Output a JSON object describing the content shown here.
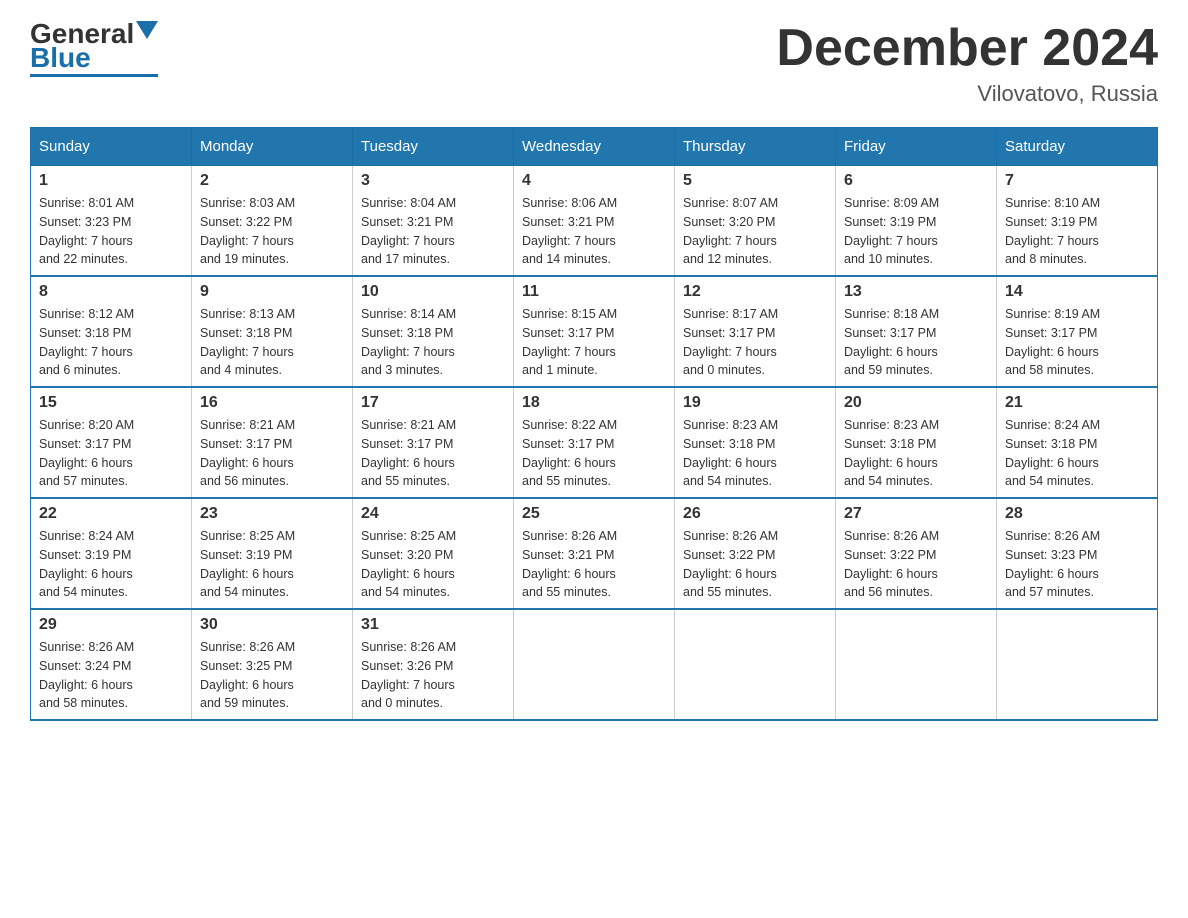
{
  "header": {
    "logo_general": "General",
    "logo_blue": "Blue",
    "month_title": "December 2024",
    "location": "Vilovatovo, Russia"
  },
  "calendar": {
    "days_of_week": [
      "Sunday",
      "Monday",
      "Tuesday",
      "Wednesday",
      "Thursday",
      "Friday",
      "Saturday"
    ],
    "weeks": [
      [
        {
          "day": "1",
          "sunrise": "8:01 AM",
          "sunset": "3:23 PM",
          "daylight": "7 hours and 22 minutes."
        },
        {
          "day": "2",
          "sunrise": "8:03 AM",
          "sunset": "3:22 PM",
          "daylight": "7 hours and 19 minutes."
        },
        {
          "day": "3",
          "sunrise": "8:04 AM",
          "sunset": "3:21 PM",
          "daylight": "7 hours and 17 minutes."
        },
        {
          "day": "4",
          "sunrise": "8:06 AM",
          "sunset": "3:21 PM",
          "daylight": "7 hours and 14 minutes."
        },
        {
          "day": "5",
          "sunrise": "8:07 AM",
          "sunset": "3:20 PM",
          "daylight": "7 hours and 12 minutes."
        },
        {
          "day": "6",
          "sunrise": "8:09 AM",
          "sunset": "3:19 PM",
          "daylight": "7 hours and 10 minutes."
        },
        {
          "day": "7",
          "sunrise": "8:10 AM",
          "sunset": "3:19 PM",
          "daylight": "7 hours and 8 minutes."
        }
      ],
      [
        {
          "day": "8",
          "sunrise": "8:12 AM",
          "sunset": "3:18 PM",
          "daylight": "7 hours and 6 minutes."
        },
        {
          "day": "9",
          "sunrise": "8:13 AM",
          "sunset": "3:18 PM",
          "daylight": "7 hours and 4 minutes."
        },
        {
          "day": "10",
          "sunrise": "8:14 AM",
          "sunset": "3:18 PM",
          "daylight": "7 hours and 3 minutes."
        },
        {
          "day": "11",
          "sunrise": "8:15 AM",
          "sunset": "3:17 PM",
          "daylight": "7 hours and 1 minute."
        },
        {
          "day": "12",
          "sunrise": "8:17 AM",
          "sunset": "3:17 PM",
          "daylight": "7 hours and 0 minutes."
        },
        {
          "day": "13",
          "sunrise": "8:18 AM",
          "sunset": "3:17 PM",
          "daylight": "6 hours and 59 minutes."
        },
        {
          "day": "14",
          "sunrise": "8:19 AM",
          "sunset": "3:17 PM",
          "daylight": "6 hours and 58 minutes."
        }
      ],
      [
        {
          "day": "15",
          "sunrise": "8:20 AM",
          "sunset": "3:17 PM",
          "daylight": "6 hours and 57 minutes."
        },
        {
          "day": "16",
          "sunrise": "8:21 AM",
          "sunset": "3:17 PM",
          "daylight": "6 hours and 56 minutes."
        },
        {
          "day": "17",
          "sunrise": "8:21 AM",
          "sunset": "3:17 PM",
          "daylight": "6 hours and 55 minutes."
        },
        {
          "day": "18",
          "sunrise": "8:22 AM",
          "sunset": "3:17 PM",
          "daylight": "6 hours and 55 minutes."
        },
        {
          "day": "19",
          "sunrise": "8:23 AM",
          "sunset": "3:18 PM",
          "daylight": "6 hours and 54 minutes."
        },
        {
          "day": "20",
          "sunrise": "8:23 AM",
          "sunset": "3:18 PM",
          "daylight": "6 hours and 54 minutes."
        },
        {
          "day": "21",
          "sunrise": "8:24 AM",
          "sunset": "3:18 PM",
          "daylight": "6 hours and 54 minutes."
        }
      ],
      [
        {
          "day": "22",
          "sunrise": "8:24 AM",
          "sunset": "3:19 PM",
          "daylight": "6 hours and 54 minutes."
        },
        {
          "day": "23",
          "sunrise": "8:25 AM",
          "sunset": "3:19 PM",
          "daylight": "6 hours and 54 minutes."
        },
        {
          "day": "24",
          "sunrise": "8:25 AM",
          "sunset": "3:20 PM",
          "daylight": "6 hours and 54 minutes."
        },
        {
          "day": "25",
          "sunrise": "8:26 AM",
          "sunset": "3:21 PM",
          "daylight": "6 hours and 55 minutes."
        },
        {
          "day": "26",
          "sunrise": "8:26 AM",
          "sunset": "3:22 PM",
          "daylight": "6 hours and 55 minutes."
        },
        {
          "day": "27",
          "sunrise": "8:26 AM",
          "sunset": "3:22 PM",
          "daylight": "6 hours and 56 minutes."
        },
        {
          "day": "28",
          "sunrise": "8:26 AM",
          "sunset": "3:23 PM",
          "daylight": "6 hours and 57 minutes."
        }
      ],
      [
        {
          "day": "29",
          "sunrise": "8:26 AM",
          "sunset": "3:24 PM",
          "daylight": "6 hours and 58 minutes."
        },
        {
          "day": "30",
          "sunrise": "8:26 AM",
          "sunset": "3:25 PM",
          "daylight": "6 hours and 59 minutes."
        },
        {
          "day": "31",
          "sunrise": "8:26 AM",
          "sunset": "3:26 PM",
          "daylight": "7 hours and 0 minutes."
        },
        null,
        null,
        null,
        null
      ]
    ]
  },
  "labels": {
    "sunrise_label": "Sunrise:",
    "sunset_label": "Sunset:",
    "daylight_label": "Daylight:"
  }
}
